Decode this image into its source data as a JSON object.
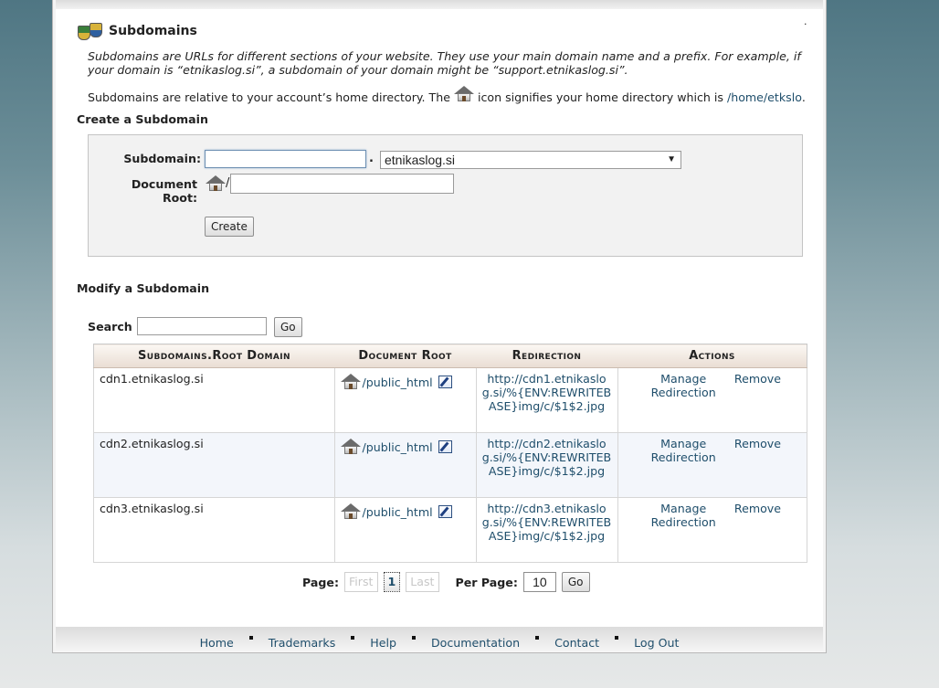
{
  "header": {
    "title": "Subdomains",
    "title_icon": "shield-logos-icon"
  },
  "intro": {
    "description": "Subdomains are URLs for different sections of your website. They use your main domain name and a prefix. For example, if your domain is “etnikaslog.si”, a subdomain of your domain might be “support.etnikaslog.si”.",
    "home_text_before": "Subdomains are relative to your account’s home directory. The",
    "home_text_after": "icon signifies your home directory which is",
    "home_dir": "/home/etkslo",
    "period": "."
  },
  "create": {
    "section_title": "Create a Subdomain",
    "subdomain_label": "Subdomain:",
    "subdomain_value": "",
    "dot": ".",
    "domain_selected": "etnikaslog.si",
    "docroot_label": "Document Root:",
    "docroot_prefix": "/",
    "docroot_value": "",
    "create_button": "Create"
  },
  "modify": {
    "section_title": "Modify a Subdomain",
    "search_label": "Search",
    "search_value": "",
    "go_button": "Go",
    "columns": [
      "Subdomains.Root Domain",
      "Document Root",
      "Redirection",
      "Actions"
    ],
    "rows": [
      {
        "domain": "cdn1.etnikaslog.si",
        "docroot": "/public_html",
        "redirection": "http://cdn1.etnikaslog.si/%{ENV:REWRITEBASE}img/c/$1$2.jpg",
        "manage": "Manage Redirection",
        "remove": "Remove"
      },
      {
        "domain": "cdn2.etnikaslog.si",
        "docroot": "/public_html",
        "redirection": "http://cdn2.etnikaslog.si/%{ENV:REWRITEBASE}img/c/$1$2.jpg",
        "manage": "Manage Redirection",
        "remove": "Remove"
      },
      {
        "domain": "cdn3.etnikaslog.si",
        "docroot": "/public_html",
        "redirection": "http://cdn3.etnikaslog.si/%{ENV:REWRITEBASE}img/c/$1$2.jpg",
        "manage": "Manage Redirection",
        "remove": "Remove"
      }
    ]
  },
  "pagination": {
    "page_label": "Page:",
    "first": "First",
    "current": "1",
    "last": "Last",
    "per_page_label": "Per Page:",
    "per_page_value": "10",
    "go_button": "Go"
  },
  "footer": {
    "links": [
      "Home",
      "Trademarks",
      "Help",
      "Documentation",
      "Contact",
      "Log Out"
    ]
  },
  "colors": {
    "link": "#1f4e6b",
    "header_gradient_start": "#fbf7f3",
    "header_gradient_end": "#e9ddd3",
    "background_top": "#4f7683"
  }
}
